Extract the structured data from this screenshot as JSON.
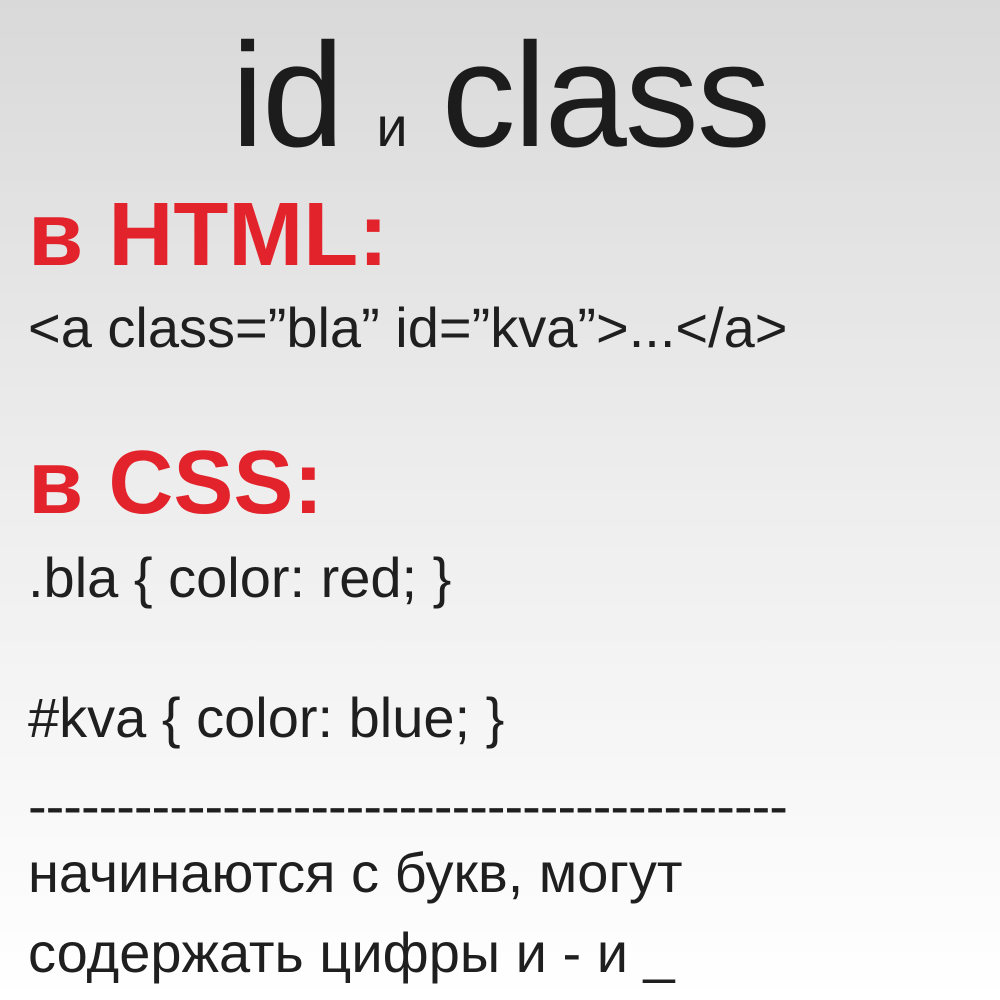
{
  "title": {
    "part1": "id",
    "part2": "и",
    "part3": "class"
  },
  "html_section": {
    "heading": "в HTML:",
    "code": "<a class=”bla” id=”kva”>...</a>"
  },
  "css_section": {
    "heading": "в CSS:",
    "rule1": ".bla { color: red; }",
    "rule2": "#kva { color: blue; }"
  },
  "divider": "-------------------------------------------",
  "note": {
    "line1": "начинаются с букв, могут",
    "line2": "содержать цифры и - и _"
  },
  "colors": {
    "heading_red": "#e3232b",
    "text_dark": "#1f1f1f"
  }
}
